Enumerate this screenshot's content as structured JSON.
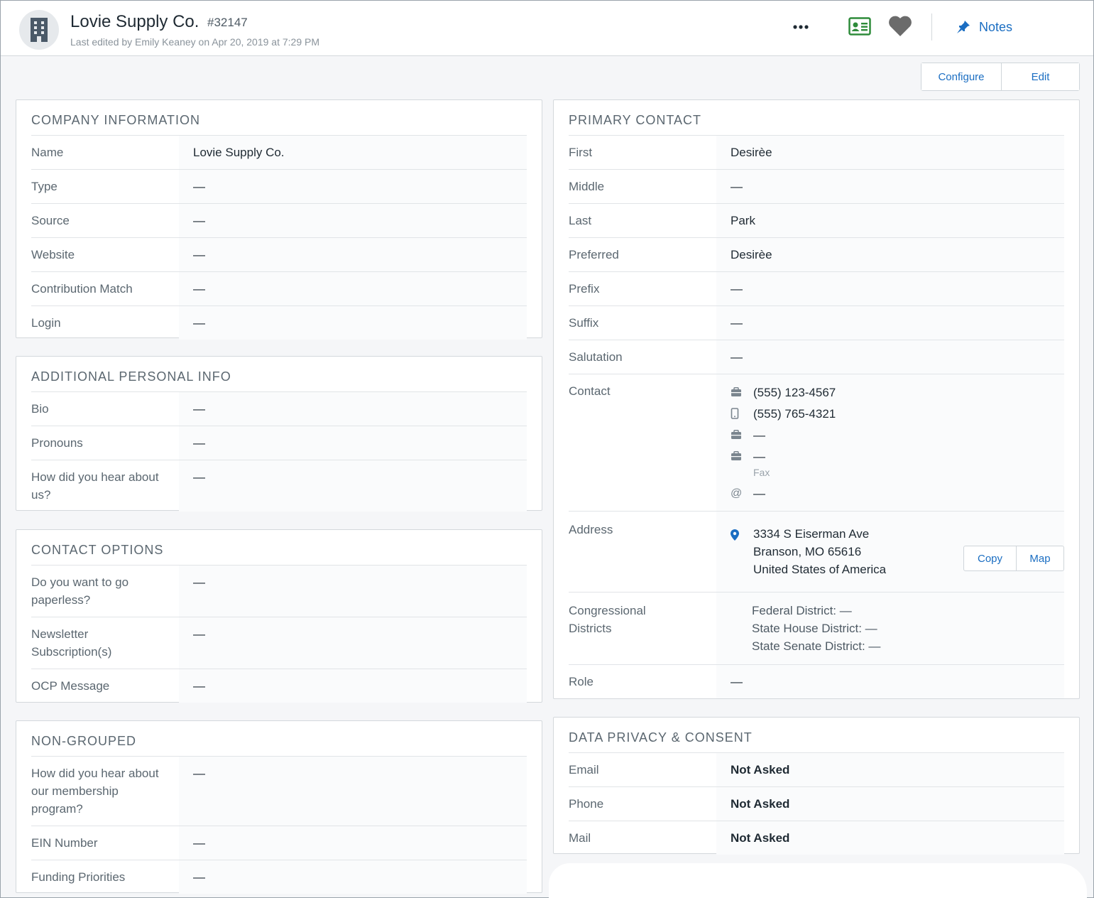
{
  "header": {
    "title": "Lovie Supply Co.",
    "record_id": "#32147",
    "subtitle": "Last edited by Emily Keaney on Apr 20, 2019 at 7:29 PM",
    "notes_label": "Notes",
    "icons": [
      "building-icon",
      "more-icon",
      "contact-card-icon",
      "heart-icon",
      "pin-icon"
    ]
  },
  "toolbar": {
    "configure_label": "Configure",
    "edit_label": "Edit"
  },
  "company_info": {
    "title": "COMPANY INFORMATION",
    "rows": [
      {
        "label": "Name",
        "value": "Lovie Supply Co."
      },
      {
        "label": "Type",
        "value": "—"
      },
      {
        "label": "Source",
        "value": "—"
      },
      {
        "label": "Website",
        "value": "—"
      },
      {
        "label": "Contribution Match",
        "value": "—"
      },
      {
        "label": "Login",
        "value": "—"
      }
    ]
  },
  "additional_info": {
    "title": "ADDITIONAL PERSONAL INFO",
    "rows": [
      {
        "label": "Bio",
        "value": "—"
      },
      {
        "label": "Pronouns",
        "value": "—"
      },
      {
        "label": "How did you hear about us?",
        "value": "—"
      }
    ]
  },
  "contact_options": {
    "title": "CONTACT OPTIONS",
    "rows": [
      {
        "label": "Do you want to go paperless?",
        "value": "—"
      },
      {
        "label": "Newsletter Subscription(s)",
        "value": "—"
      },
      {
        "label": "OCP Message",
        "value": "—"
      }
    ]
  },
  "non_grouped": {
    "title": "NON-GROUPED",
    "rows": [
      {
        "label": "How did you hear about our membership program?",
        "value": "—"
      },
      {
        "label": "EIN Number",
        "value": "—"
      },
      {
        "label": "Funding Priorities",
        "value": "—"
      }
    ]
  },
  "primary_contact": {
    "title": "PRIMARY CONTACT",
    "rows": [
      {
        "label": "First",
        "value": "Desirèe"
      },
      {
        "label": "Middle",
        "value": "—"
      },
      {
        "label": "Last",
        "value": "Park"
      },
      {
        "label": "Preferred",
        "value": "Desirèe"
      },
      {
        "label": "Prefix",
        "value": "—"
      },
      {
        "label": "Suffix",
        "value": "—"
      },
      {
        "label": "Salutation",
        "value": "—"
      }
    ],
    "contact_label": "Contact",
    "work_phone": "(555) 123-4567",
    "mobile_phone": "(555) 765-4321",
    "other_phone": "—",
    "fax": "—",
    "fax_label": "Fax",
    "email": "—",
    "address_label": "Address",
    "address_line1": "3334 S Eiserman Ave",
    "address_line2": "Branson, MO 65616",
    "address_line3": "United States of America",
    "copy_label": "Copy",
    "map_label": "Map",
    "districts_label": "Congressional Districts",
    "federal_district": "Federal District: —",
    "state_house_district": "State House District: —",
    "state_senate_district": "State Senate District: —",
    "role_label": "Role",
    "role_value": "—"
  },
  "privacy": {
    "title": "DATA PRIVACY & CONSENT",
    "rows": [
      {
        "label": "Email",
        "value": "Not Asked"
      },
      {
        "label": "Phone",
        "value": "Not Asked"
      },
      {
        "label": "Mail",
        "value": "Not Asked"
      }
    ]
  },
  "colors": {
    "accent": "#1b6ec2",
    "card_icon": "#2e8b3a",
    "heart": "#6b6b6b"
  }
}
